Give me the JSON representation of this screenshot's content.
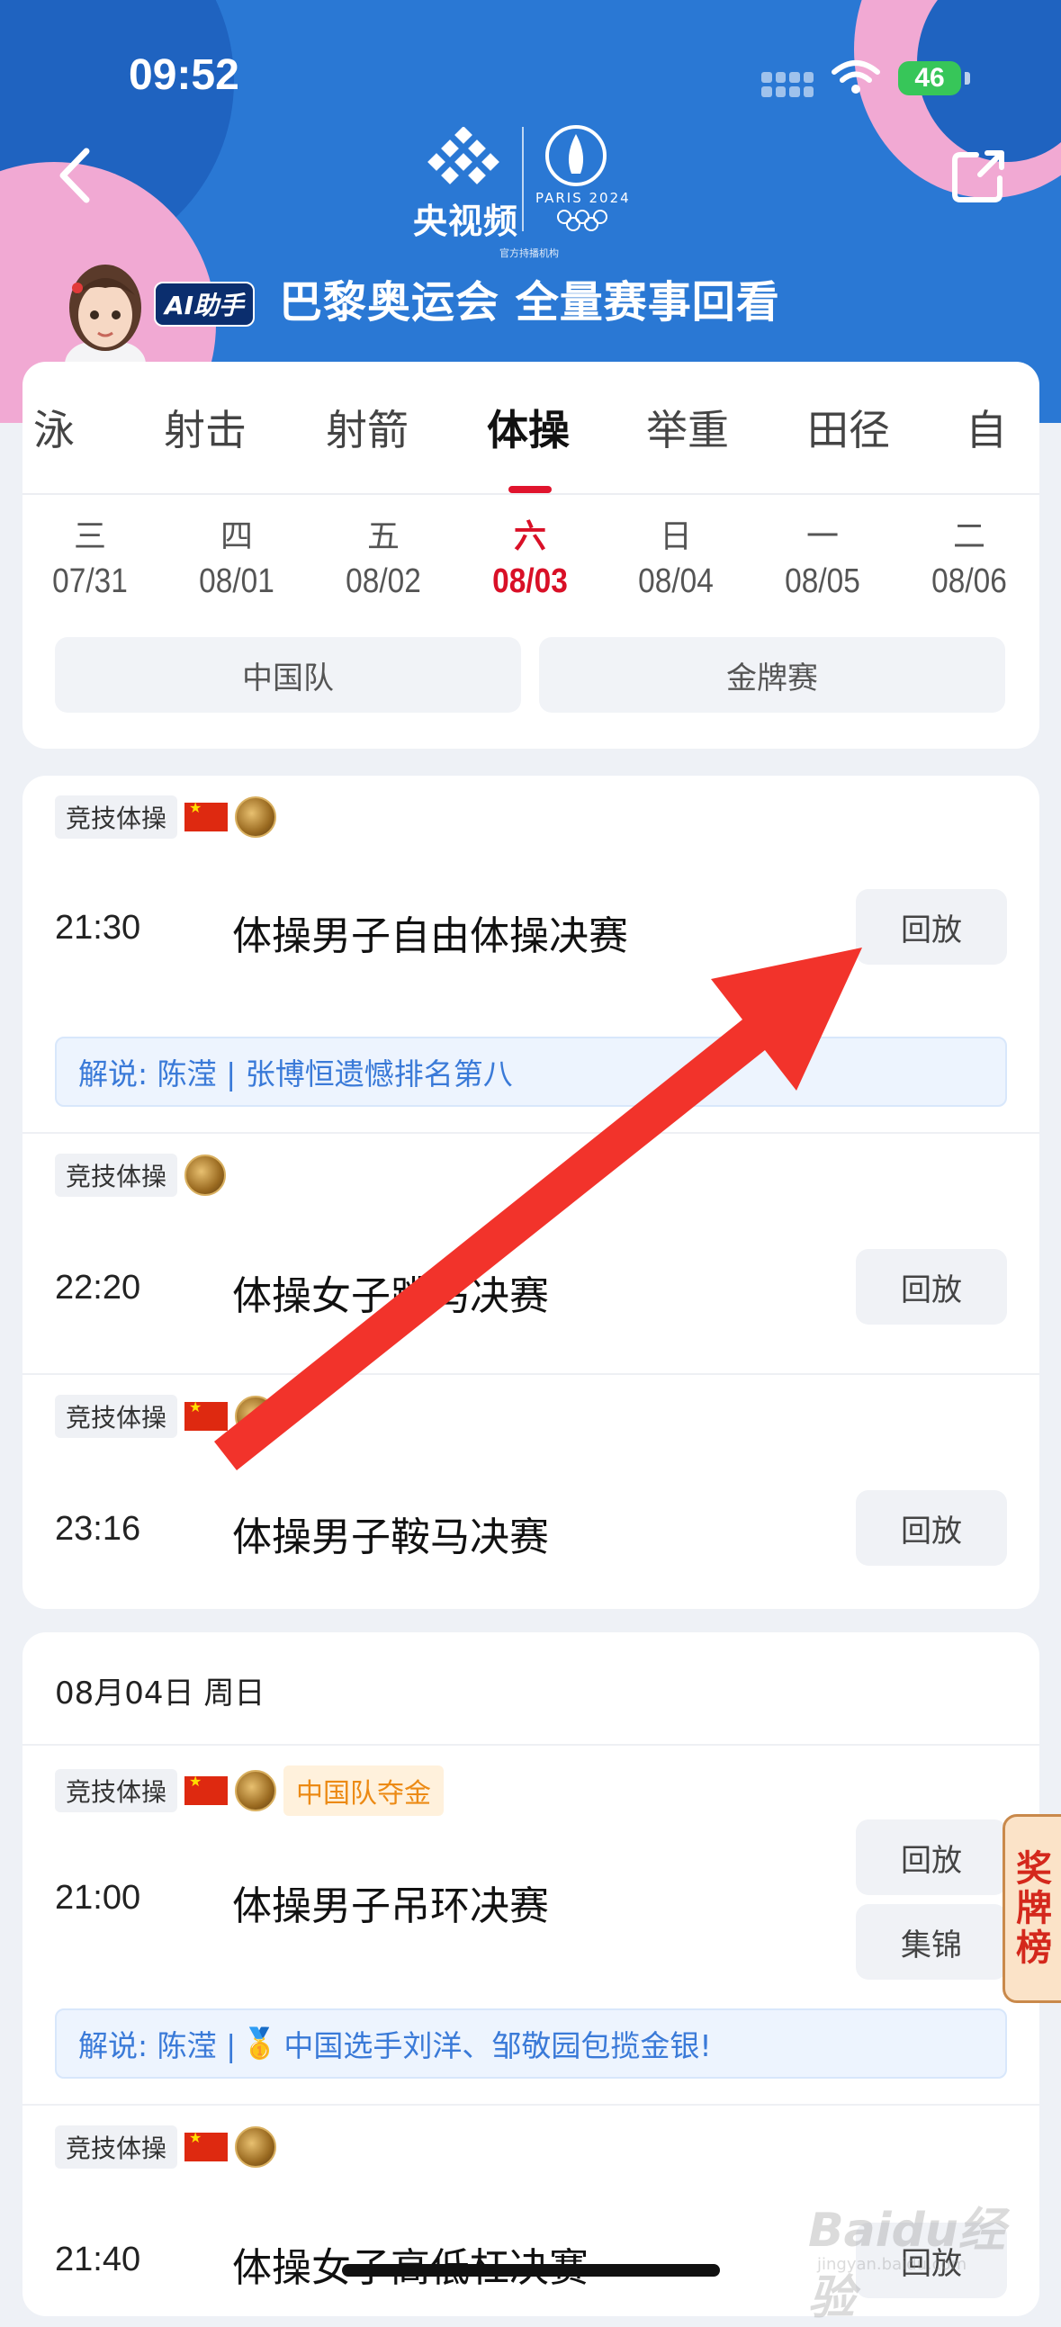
{
  "status_bar": {
    "time": "09:52",
    "battery": "46"
  },
  "header": {
    "logo_name": "央视频",
    "paris_text": "PARIS 2024",
    "logo_sub": "官方持播机构",
    "ai_badge": "AI助手",
    "banner_title": "巴黎奥运会 全量赛事回看"
  },
  "tabs": [
    "泳",
    "射击",
    "射箭",
    "体操",
    "举重",
    "田径",
    "自"
  ],
  "active_tab": "体操",
  "days": [
    {
      "weekday": "三",
      "date": "07/31"
    },
    {
      "weekday": "四",
      "date": "08/01"
    },
    {
      "weekday": "五",
      "date": "08/02"
    },
    {
      "weekday": "六",
      "date": "08/03",
      "active": true
    },
    {
      "weekday": "日",
      "date": "08/04"
    },
    {
      "weekday": "一",
      "date": "08/05"
    },
    {
      "weekday": "二",
      "date": "08/06"
    }
  ],
  "filters": {
    "china_team": "中国队",
    "gold_medal": "金牌赛"
  },
  "events": [
    {
      "category": "竞技体操",
      "time": "21:30",
      "name": "体操男子自由体操决赛",
      "button": "回放",
      "comment": "解说: 陈滢 | 张博恒遗憾排名第八"
    },
    {
      "category": "竞技体操",
      "time": "22:20",
      "name": "体操女子跳马决赛",
      "button": "回放"
    },
    {
      "category": "竞技体操",
      "time": "23:16",
      "name": "体操男子鞍马决赛",
      "button": "回放"
    }
  ],
  "second_day": {
    "header": "08月04日 周日",
    "events": [
      {
        "category": "竞技体操",
        "win_tag": "中国队夺金",
        "time": "21:00",
        "name": "体操男子吊环决赛",
        "button_replay": "回放",
        "button_highlights": "集锦",
        "comment_prefix": "解说: 陈滢 | ",
        "comment_medal": "🥇",
        "comment_text": "中国选手刘洋、邹敬园包揽金银!"
      },
      {
        "category": "竞技体操",
        "time": "21:40",
        "name": "体操女子高低杠决赛",
        "button": "回放"
      }
    ]
  },
  "medal_tab": [
    "奖",
    "牌",
    "榜"
  ],
  "watermark": {
    "brand": "Baidu经验",
    "url": "jingyan.baidu.com"
  },
  "colors": {
    "accent_red": "#e0142d",
    "header_blue": "#2a78d4",
    "arrow_red": "#f2332b",
    "comment_blue": "#3a7ad8"
  }
}
